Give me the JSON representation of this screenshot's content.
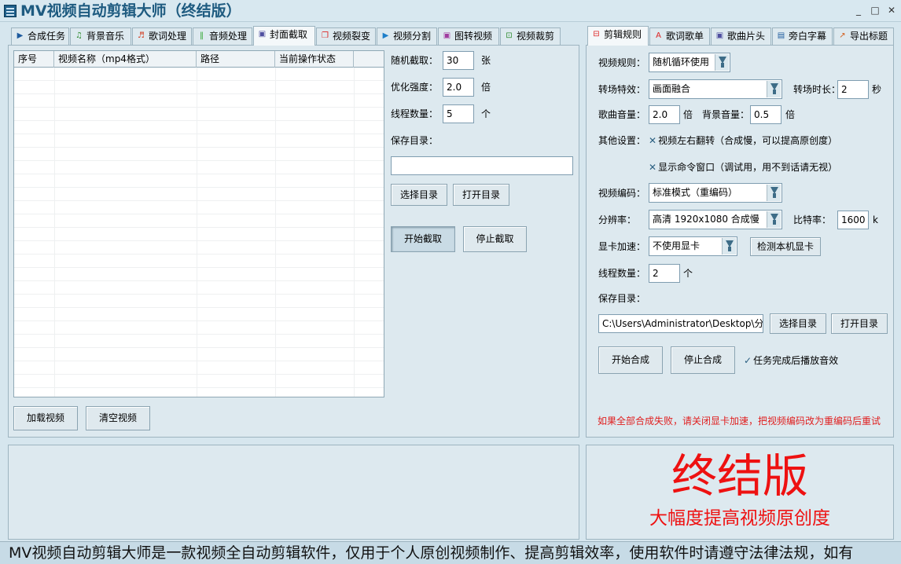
{
  "window": {
    "title": "MV视频自动剪辑大师（终结版）",
    "minimize": "_",
    "restore": "□",
    "close": "✕"
  },
  "left_tabs": [
    {
      "label": "合成任务",
      "icon": "play-icon",
      "glyph": "▶",
      "color": "#1e5b9e"
    },
    {
      "label": "背景音乐",
      "icon": "music-note-icon",
      "glyph": "♫",
      "color": "#2b8a2b"
    },
    {
      "label": "歌词处理",
      "icon": "lyrics-icon",
      "glyph": "♬",
      "color": "#d23b1f"
    },
    {
      "label": "音频处理",
      "icon": "audio-wave-icon",
      "glyph": "‖",
      "color": "#36a836"
    },
    {
      "label": "封面截取",
      "icon": "image-icon",
      "glyph": "▣",
      "color": "#4f4fa0"
    },
    {
      "label": "视频裂变",
      "icon": "copy-icon",
      "glyph": "❐",
      "color": "#d22"
    },
    {
      "label": "视频分割",
      "icon": "video-split-icon",
      "glyph": "▶",
      "color": "#1e7fc9"
    },
    {
      "label": "图转视频",
      "icon": "image-to-video-icon",
      "glyph": "▣",
      "color": "#a03ca0"
    },
    {
      "label": "视频裁剪",
      "icon": "crop-icon",
      "glyph": "⊡",
      "color": "#2b8a2b"
    }
  ],
  "active_left_tab": "封面截取",
  "table": {
    "headers": [
      "序号",
      "视频名称（mp4格式）",
      "路径",
      "当前操作状态"
    ],
    "rows": []
  },
  "cover": {
    "random_label": "随机截取：",
    "random_value": "30",
    "random_unit": "张",
    "optimize_label": "优化强度：",
    "optimize_value": "2.0",
    "optimize_unit": "倍",
    "thread_label": "线程数量：",
    "thread_value": "5",
    "thread_unit": "个",
    "save_dir_label": "保存目录：",
    "save_dir_value": "",
    "select_dir": "选择目录",
    "open_dir": "打开目录",
    "start": "开始截取",
    "stop": "停止截取"
  },
  "load_video": "加载视频",
  "clear_video": "清空视频",
  "right_tabs": [
    {
      "label": "剪辑规则",
      "icon": "clip-rules-icon",
      "glyph": "⊟",
      "color": "#d22"
    },
    {
      "label": "歌词歌单",
      "icon": "font-icon",
      "glyph": "A",
      "color": "#d22"
    },
    {
      "label": "歌曲片头",
      "icon": "image-icon",
      "glyph": "▣",
      "color": "#4f4fa0"
    },
    {
      "label": "旁白字幕",
      "icon": "document-icon",
      "glyph": "▤",
      "color": "#1e5b9e"
    },
    {
      "label": "导出标题",
      "icon": "export-icon",
      "glyph": "↗",
      "color": "#d2601f"
    }
  ],
  "active_right_tab": "剪辑规则",
  "rules": {
    "video_rule_label": "视频规则：",
    "video_rule_value": "随机循环使用",
    "transition_label": "转场特效：",
    "transition_value": "画面融合",
    "transition_duration_label": "转场时长：",
    "transition_duration_value": "2",
    "transition_duration_unit": "秒",
    "song_volume_label": "歌曲音量：",
    "song_volume_value": "2.0",
    "song_volume_unit": "倍",
    "bg_volume_label": "背景音量：",
    "bg_volume_value": "0.5",
    "bg_volume_unit": "倍",
    "other_label": "其他设置：",
    "flip_option": "视频左右翻转（合成慢，可以提高原创度）",
    "console_option": "显示命令窗口（调试用，用不到话请无视）",
    "encoding_label": "视频编码：",
    "encoding_value": "标准模式（重编码）",
    "resolution_label": "分辨率：",
    "resolution_value": "高清 1920x1080 合成慢",
    "bitrate_label": "比特率：",
    "bitrate_value": "1600",
    "bitrate_unit": "k",
    "gpu_label": "显卡加速：",
    "gpu_value": "不使用显卡",
    "detect_gpu": "检测本机显卡",
    "thread_label": "线程数量：",
    "thread_value": "2",
    "thread_unit": "个",
    "save_dir_label": "保存目录：",
    "save_dir_value": "C:\\Users\\Administrator\\Desktop\\分镜",
    "select_dir": "选择目录",
    "open_dir": "打开目录",
    "start": "开始合成",
    "stop": "停止合成",
    "sound_option": "任务完成后播放音效",
    "warning": "如果全部合成失败，请关闭显卡加速，把视频编码改为重编码后重试"
  },
  "promo": {
    "title": "终结版",
    "subtitle": "大幅度提高视频原创度"
  },
  "marquee": "MV视频自动剪辑大师是一款视频全自动剪辑软件，仅用于个人原创视频制作、提高剪辑效率，使用软件时请遵守法律法规，如有"
}
